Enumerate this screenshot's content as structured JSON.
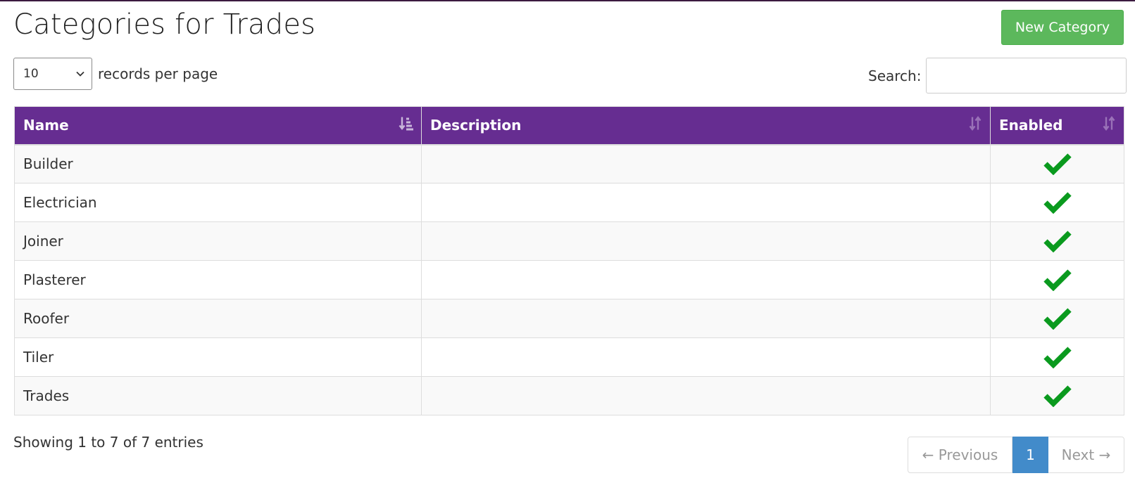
{
  "page": {
    "title": "Categories for Trades",
    "new_button_label": "New Category"
  },
  "length": {
    "selected": "10",
    "suffix_label": "records per page"
  },
  "search": {
    "label": "Search:",
    "value": ""
  },
  "table": {
    "columns": [
      {
        "label": "Name",
        "sort": "ascending"
      },
      {
        "label": "Description",
        "sort": "none"
      },
      {
        "label": "Enabled",
        "sort": "none"
      }
    ],
    "rows": [
      {
        "name": "Builder",
        "description": "",
        "enabled": true
      },
      {
        "name": "Electrician",
        "description": "",
        "enabled": true
      },
      {
        "name": "Joiner",
        "description": "",
        "enabled": true
      },
      {
        "name": "Plasterer",
        "description": "",
        "enabled": true
      },
      {
        "name": "Roofer",
        "description": "",
        "enabled": true
      },
      {
        "name": "Tiler",
        "description": "",
        "enabled": true
      },
      {
        "name": "Trades",
        "description": "",
        "enabled": true
      }
    ],
    "enabled_icon": "checkmark-icon"
  },
  "footer": {
    "info": "Showing 1 to 7 of 7 entries",
    "prev_label": "← Previous",
    "current_page": "1",
    "next_label": "Next →"
  },
  "colors": {
    "header_bg": "#662d91",
    "new_button": "#5cb85c",
    "active_page": "#428bca",
    "check": "#0a9a1e"
  }
}
